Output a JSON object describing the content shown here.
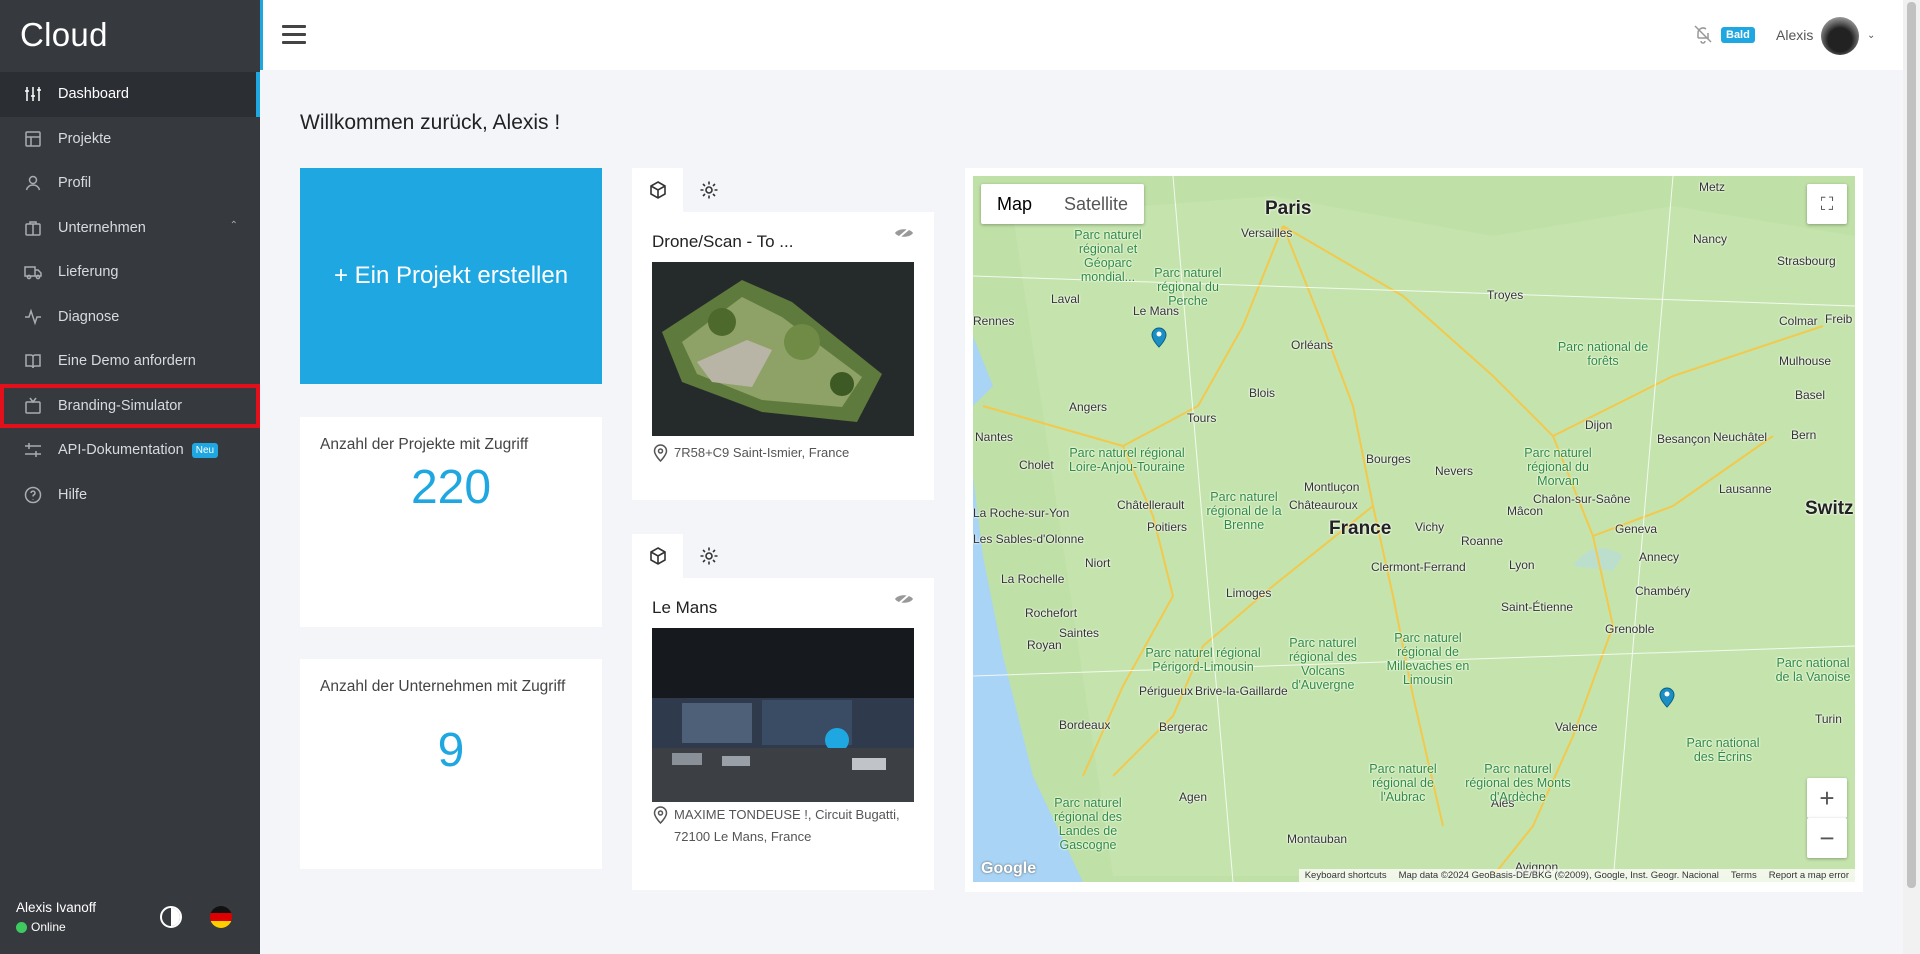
{
  "sidebar": {
    "brand": "Cloud",
    "items": [
      {
        "label": "Dashboard",
        "icon": "sliders-icon"
      },
      {
        "label": "Projekte",
        "icon": "layout-icon"
      },
      {
        "label": "Profil",
        "icon": "user-icon"
      },
      {
        "label": "Unternehmen",
        "icon": "briefcase-icon"
      },
      {
        "label": "Lieferung",
        "icon": "truck-icon"
      },
      {
        "label": "Diagnose",
        "icon": "activity-icon"
      },
      {
        "label": "Eine Demo anfordern",
        "icon": "book-icon"
      },
      {
        "label": "Branding-Simulator",
        "icon": "tv-icon"
      },
      {
        "label": "API-Dokumentation",
        "icon": "code-icon",
        "badge": "Neu"
      },
      {
        "label": "Hilfe",
        "icon": "help-circle-icon"
      }
    ],
    "user": {
      "name": "Alexis Ivanoff",
      "status": "Online"
    }
  },
  "topbar": {
    "bell_badge": "Bald",
    "user_name": "Alexis"
  },
  "main": {
    "welcome": "Willkommen zurück, Alexis !",
    "create_button": "+ Ein Projekt erstellen",
    "stats": [
      {
        "label": "Anzahl der Projekte mit Zugriff",
        "value": "220"
      },
      {
        "label": "Anzahl der Unternehmen mit Zugriff",
        "value": "9"
      }
    ],
    "projects": [
      {
        "title": "Drone/Scan - To ...",
        "location": "7R58+C9 Saint-Ismier, France"
      },
      {
        "title": "Le Mans",
        "location": "MAXIME TONDEUSE !, Circuit Bugatti, 72100 Le Mans, France"
      }
    ]
  },
  "map": {
    "type_options": [
      "Map",
      "Satellite"
    ],
    "selected_type": "Map",
    "labels": {
      "country": "France",
      "cities": [
        "Paris",
        "Versailles",
        "Laval",
        "Le Mans",
        "Orléans",
        "Angers",
        "Tours",
        "Blois",
        "Nantes",
        "Bourges",
        "Nevers",
        "Dijon",
        "Besançon",
        "Troyes",
        "Nancy",
        "Metz",
        "Strasbourg",
        "Colmar",
        "Mulhouse",
        "Basel",
        "Bern",
        "Neuchâtel",
        "Lausanne",
        "Geneva",
        "Annecy",
        "Chambéry",
        "Grenoble",
        "Lyon",
        "Mâcon",
        "Vichy",
        "Roanne",
        "Saint-Étienne",
        "Clermont-Ferrand",
        "Montluçon",
        "Limoges",
        "Poitiers",
        "Châtellerault",
        "Châteauroux",
        "Chalon-sur-Saône",
        "Cholet",
        "La Rochelle",
        "Rochefort",
        "Niort",
        "Saintes",
        "Royan",
        "Périgueux",
        "Brive-la-Gaillarde",
        "Bordeaux",
        "Bergerac",
        "Agen",
        "Montauban",
        "Valence",
        "Avignon",
        "Alès",
        "La Roche-sur-Yon",
        "Les Sables-d'Olonne",
        "Rennes",
        "Switz",
        "Turin",
        "Freib"
      ],
      "parks": [
        "Parc naturel régional et Géoparc mondial...",
        "Parc naturel régional du Perche",
        "Parc naturel régional Loire-Anjou-Touraine",
        "Parc naturel régional de la Brenne",
        "Parc naturel régional du Morvan",
        "Parc national de forêts",
        "Parc naturel régional des Volcans d'Auvergne",
        "Parc naturel régional de Millevaches en Limousin",
        "Parc naturel régional Périgord-Limousin",
        "Parc naturel régional des Landes de Gascogne",
        "Parc naturel régional de l'Aubrac",
        "Parc naturel régional des Monts d'Ardèche",
        "Parc national des Écrins",
        "Parc national de la Vanoise"
      ]
    },
    "footer": [
      "Keyboard shortcuts",
      "Map data ©2024 GeoBasis-DE/BKG (©2009), Google, Inst. Geogr. Nacional",
      "Terms",
      "Report a map error"
    ],
    "google": "Google"
  },
  "colors": {
    "accent": "#1fa7e1",
    "sidebar": "#363a3f",
    "highlight": "#e2101b",
    "online": "#3fca5f"
  }
}
